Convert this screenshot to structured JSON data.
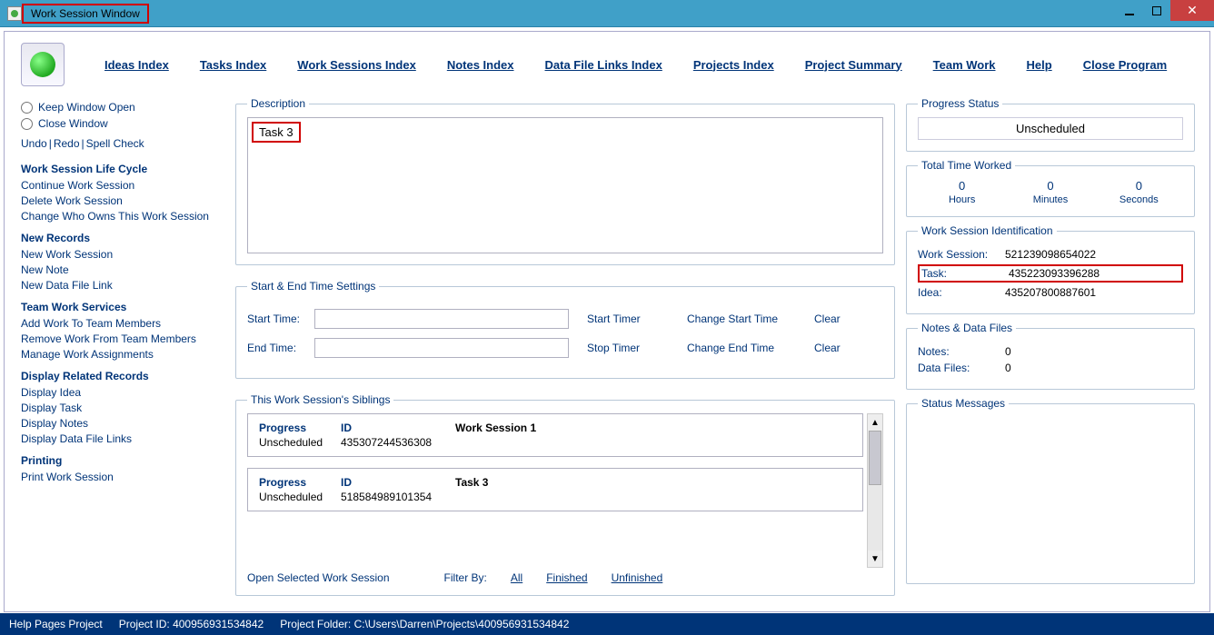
{
  "window_title": "Work Session Window",
  "menu": {
    "ideas_index": "Ideas Index",
    "tasks_index": "Tasks Index",
    "work_sessions_index": "Work Sessions Index",
    "notes_index": "Notes Index",
    "data_file_links_index": "Data File Links Index",
    "projects_index": "Projects Index",
    "project_summary": "Project Summary",
    "team_work": "Team Work",
    "help": "Help",
    "close_program": "Close Program"
  },
  "left": {
    "keep_window_open": "Keep Window Open",
    "close_window": "Close Window",
    "undo": "Undo",
    "redo": "Redo",
    "spell_check": "Spell Check",
    "life_cycle_head": "Work Session Life Cycle",
    "continue_ws": "Continue Work Session",
    "delete_ws": "Delete Work Session",
    "change_owner": "Change Who Owns This Work Session",
    "new_records_head": "New Records",
    "new_ws": "New Work Session",
    "new_note": "New Note",
    "new_dfl": "New Data File Link",
    "team_head": "Team Work Services",
    "add_team": "Add Work To Team Members",
    "remove_team": "Remove Work From Team Members",
    "manage_team": "Manage Work Assignments",
    "related_head": "Display Related Records",
    "disp_idea": "Display Idea",
    "disp_task": "Display Task",
    "disp_notes": "Display Notes",
    "disp_dfl": "Display Data File Links",
    "printing_head": "Printing",
    "print_ws": "Print Work Session"
  },
  "description": {
    "legend": "Description",
    "value": "Task 3"
  },
  "time_settings": {
    "legend": "Start & End Time Settings",
    "start_label": "Start Time:",
    "end_label": "End Time:",
    "start_value": "",
    "end_value": "",
    "start_timer": "Start Timer",
    "stop_timer": "Stop Timer",
    "change_start": "Change Start Time",
    "change_end": "Change End Time",
    "clear": "Clear"
  },
  "siblings": {
    "legend": "This Work Session's Siblings",
    "col_progress": "Progress",
    "col_id": "ID",
    "items": [
      {
        "progress": "Unscheduled",
        "id": "435307244536308",
        "title": "Work Session 1"
      },
      {
        "progress": "Unscheduled",
        "id": "518584989101354",
        "title": "Task 3"
      }
    ],
    "open_selected": "Open Selected Work Session",
    "filter_label": "Filter By:",
    "filter_all": "All",
    "filter_finished": "Finished",
    "filter_unfinished": "Unfinished"
  },
  "right": {
    "progress_legend": "Progress Status",
    "progress_value": "Unscheduled",
    "ttw_legend": "Total Time Worked",
    "hours": "0",
    "hours_label": "Hours",
    "minutes": "0",
    "minutes_label": "Minutes",
    "seconds": "0",
    "seconds_label": "Seconds",
    "ident_legend": "Work Session Identification",
    "ws_label": "Work Session:",
    "ws_val": "521239098654022",
    "task_label": "Task:",
    "task_val": "435223093396288",
    "idea_label": "Idea:",
    "idea_val": "435207800887601",
    "notes_legend": "Notes & Data Files",
    "notes_label": "Notes:",
    "notes_val": "0",
    "df_label": "Data Files:",
    "df_val": "0",
    "status_legend": "Status Messages"
  },
  "statusbar": {
    "help_pages": "Help Pages Project",
    "project_id": "Project ID: 400956931534842",
    "project_folder": "Project Folder: C:\\Users\\Darren\\Projects\\400956931534842"
  }
}
